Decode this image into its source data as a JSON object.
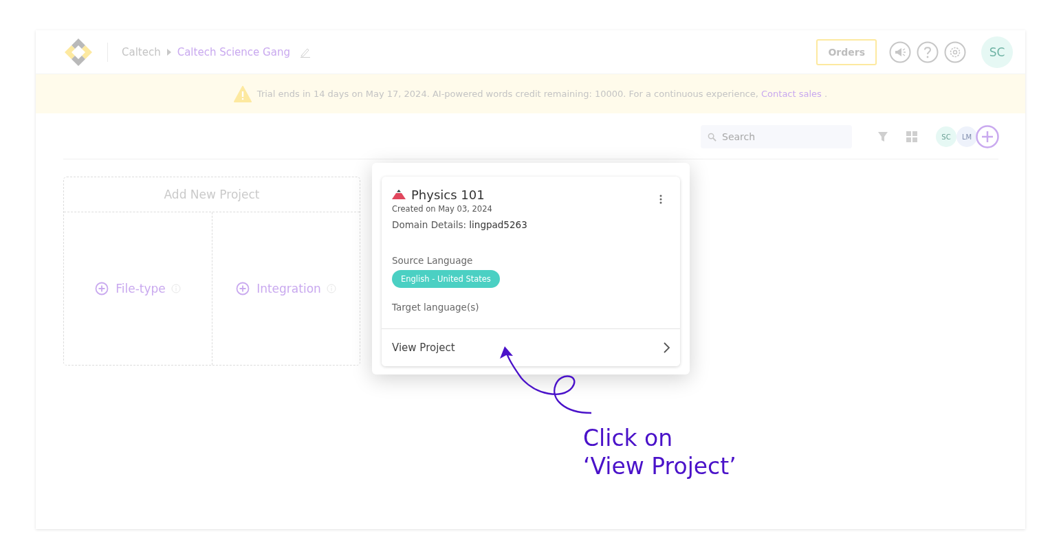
{
  "header": {
    "breadcrumb": [
      {
        "label": "Caltech",
        "selected": false
      },
      {
        "label": "Caltech Science Gang",
        "selected": true
      }
    ],
    "orders_button": "Orders",
    "avatar": "SC"
  },
  "banner": {
    "text": "Trial ends in 14 days on May 17, 2024. AI-powered words credit remaining: 10000. For a continuous experience,",
    "link": "Contact sales",
    "end": "."
  },
  "toolbar": {
    "search": {
      "placeholder": "Search"
    },
    "members": [
      {
        "initials": "SC",
        "color": "#e6f8f4"
      },
      {
        "initials": "LM",
        "color": "#eef2fb"
      }
    ]
  },
  "add_new_project": {
    "title": "Add New Project",
    "options": [
      {
        "label": "File-type"
      },
      {
        "label": "Integration"
      }
    ]
  },
  "project_card": {
    "title": "Physics 101",
    "created": "Created on May 03, 2024",
    "domain_label": "Domain Details:",
    "domain_value": "lingpad5263",
    "source_label": "Source Language",
    "source_tag": "English - United States",
    "target_label": "Target language(s)",
    "view_button": "View Project"
  },
  "annotation": {
    "lines": [
      "Click on",
      "‘View Project’"
    ]
  }
}
